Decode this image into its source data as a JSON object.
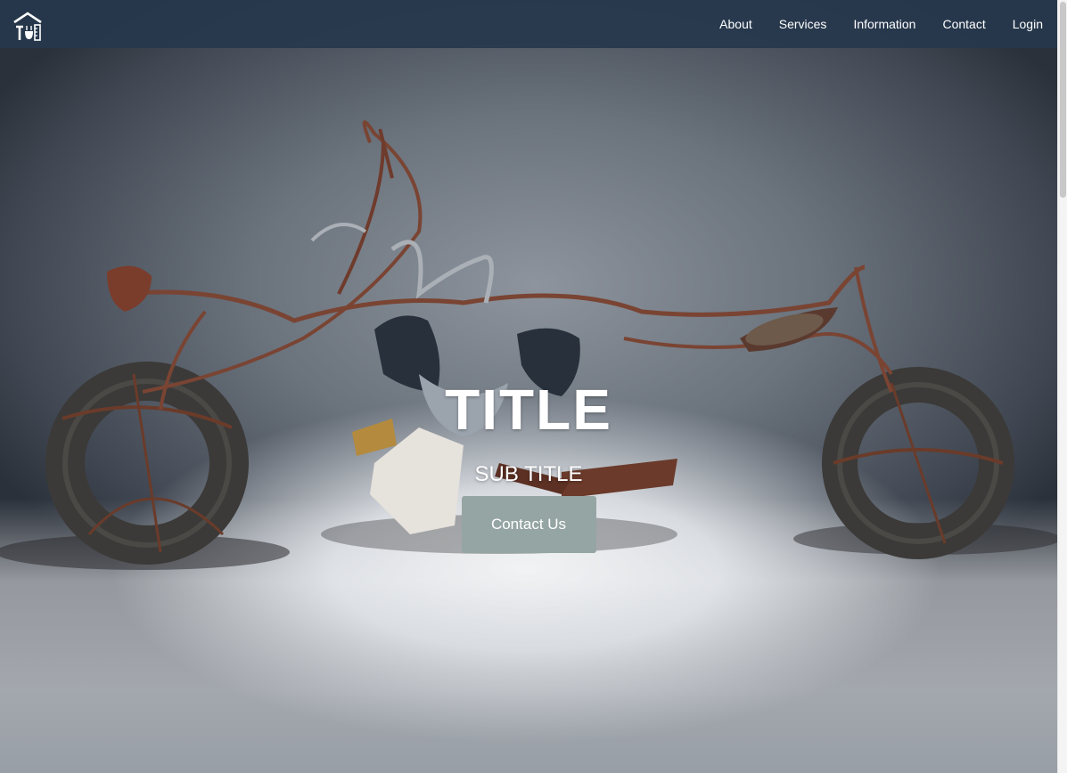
{
  "nav": {
    "logo_icon": "house-tools-logo-icon",
    "links": [
      {
        "label": "About"
      },
      {
        "label": "Services"
      },
      {
        "label": "Information"
      },
      {
        "label": "Contact"
      },
      {
        "label": "Login"
      }
    ]
  },
  "hero": {
    "title": "TITLE",
    "subtitle": "SUB TITLE",
    "cta_label": "Contact Us",
    "image_icon": "wire-motorcycle-sculpture-image"
  },
  "colors": {
    "navbar": "#26374d",
    "button": "#95a5a4",
    "text": "#ffffff"
  }
}
